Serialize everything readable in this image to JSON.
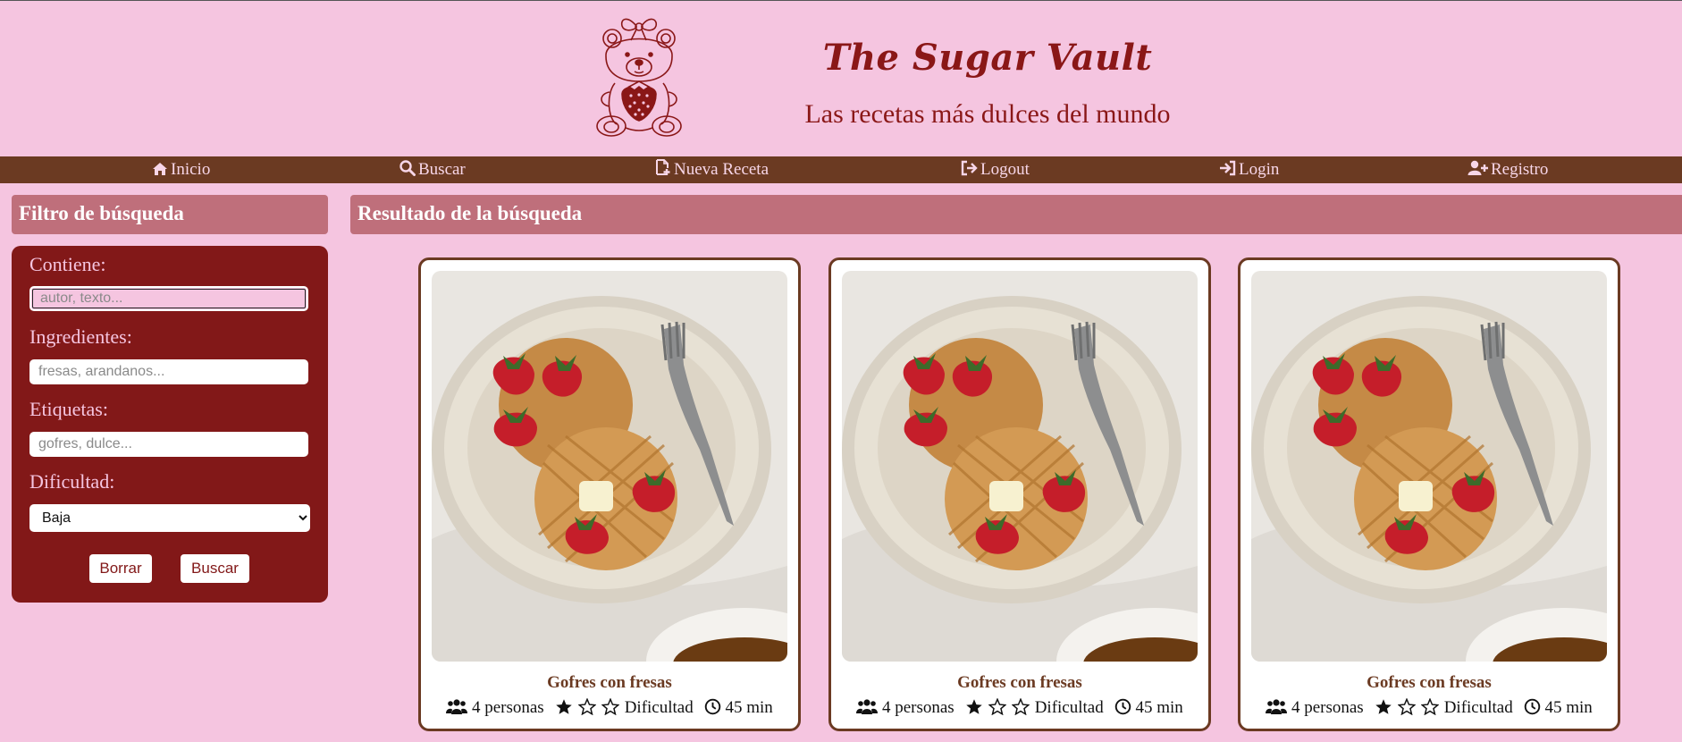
{
  "header": {
    "title": "The Sugar Vault",
    "subtitle": "Las recetas más dulces del mundo",
    "logo_icon": "teddy-bear-strawberry-icon"
  },
  "nav": {
    "items": [
      {
        "label": "Inicio",
        "icon": "home-icon"
      },
      {
        "label": "Buscar",
        "icon": "search-icon"
      },
      {
        "label": "Nueva Receta",
        "icon": "file-plus-icon"
      },
      {
        "label": "Logout",
        "icon": "logout-icon"
      },
      {
        "label": "Login",
        "icon": "login-icon"
      },
      {
        "label": "Registro",
        "icon": "user-plus-icon"
      }
    ]
  },
  "filter": {
    "title": "Filtro de búsqueda",
    "contains_label": "Contiene:",
    "contains_placeholder": "autor, texto...",
    "ingredients_label": "Ingredientes:",
    "ingredients_placeholder": "fresas, arandanos...",
    "tags_label": "Etiquetas:",
    "tags_placeholder": "gofres, dulce...",
    "difficulty_label": "Dificultad:",
    "difficulty_selected": "Baja",
    "clear_label": "Borrar",
    "search_label": "Buscar"
  },
  "results": {
    "title": "Resultado de la búsqueda",
    "cards": [
      {
        "title": "Gofres con fresas",
        "people": "4 personas",
        "difficulty": "Dificultad",
        "difficulty_level": 1,
        "difficulty_max": 3,
        "time": "45 min"
      },
      {
        "title": "Gofres con fresas",
        "people": "4 personas",
        "difficulty": "Dificultad",
        "difficulty_level": 1,
        "difficulty_max": 3,
        "time": "45 min"
      },
      {
        "title": "Gofres con fresas",
        "people": "4 personas",
        "difficulty": "Dificultad",
        "difficulty_level": 1,
        "difficulty_max": 3,
        "time": "45 min"
      }
    ]
  },
  "colors": {
    "background": "#f5c5e0",
    "brand": "#8a1717",
    "nav": "#6b3a22",
    "panel": "#821818",
    "header_bar": "#bf6f7b"
  }
}
